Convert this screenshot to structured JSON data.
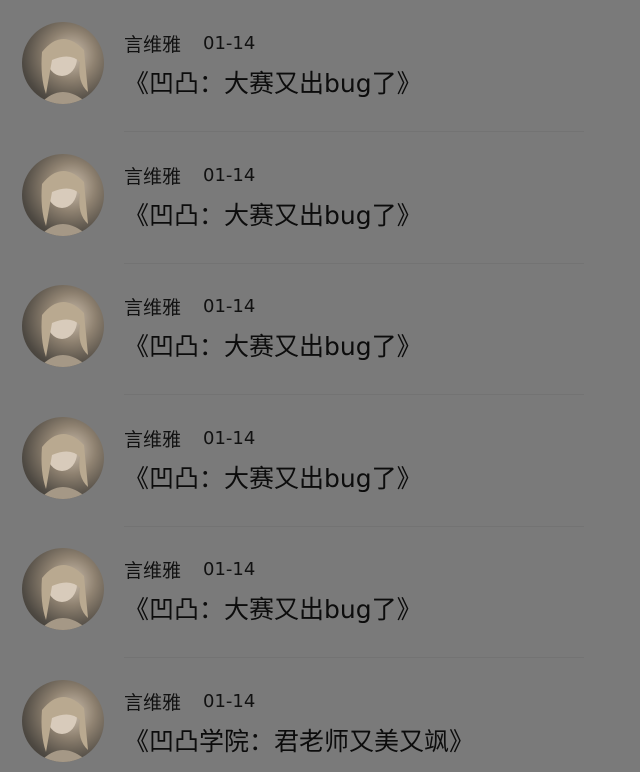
{
  "articles": [
    {
      "author": "言维雅",
      "date": "01-14",
      "title": "《凹凸：大赛又出bug了》",
      "avatar_icon": "avatar-portrait-icon"
    },
    {
      "author": "言维雅",
      "date": "01-14",
      "title": "《凹凸：大赛又出bug了》",
      "avatar_icon": "avatar-portrait-icon"
    },
    {
      "author": "言维雅",
      "date": "01-14",
      "title": "《凹凸：大赛又出bug了》",
      "avatar_icon": "avatar-portrait-icon"
    },
    {
      "author": "言维雅",
      "date": "01-14",
      "title": "《凹凸：大赛又出bug了》",
      "avatar_icon": "avatar-portrait-icon"
    },
    {
      "author": "言维雅",
      "date": "01-14",
      "title": "《凹凸：大赛又出bug了》",
      "avatar_icon": "avatar-portrait-icon"
    },
    {
      "author": "言维雅",
      "date": "01-14",
      "title": "《凹凸学院：君老师又美又飒》",
      "avatar_icon": "avatar-portrait-icon"
    }
  ],
  "colors": {
    "background": "#7a7a7a",
    "text": "#111111",
    "divider": "#737373"
  }
}
